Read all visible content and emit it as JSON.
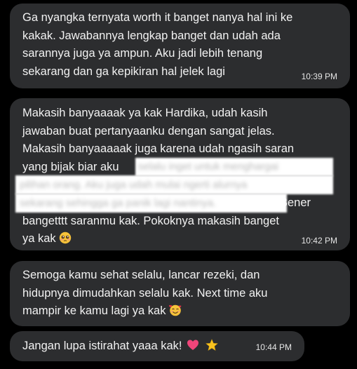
{
  "messages": [
    {
      "lines": [
        "Ga nyangka ternyata worth it banget nanya hal ini ke",
        "kakak. Jawabannya lengkap banget dan udah ada",
        "sarannya juga ya ampun. Aku jadi lebih tenang",
        "sekarang dan ga kepikiran hal jelek lagi"
      ],
      "time": "10:39 PM"
    },
    {
      "lines": [
        "Makasih banyaaaak ya kak Hardika, udah kasih",
        "jawaban buat pertanyaanku dengan sangat jelas.",
        "Makasih banyaaaaak juga karena udah ngasih saran",
        "yang bijak biar aku",
        "",
        "",
        "Bener",
        "bangetttt saranmu kak. Pokoknya makasih banget",
        "ya kak"
      ],
      "emoji": "pleading-face-emoji",
      "time": "10:42 PM",
      "redacted_hint": [
        "selalu inget untuk menghargai",
        "pilihan orang. Aku juga udah mulai ngerti alurnya",
        "sekarang sehingga ga panik lagi nantinya."
      ]
    },
    {
      "lines": [
        "Semoga kamu sehat selalu, lancar rezeki, dan",
        "hidupnya dimudahkan selalu kak. Next time aku",
        "mampir ke kamu lagi ya kak"
      ],
      "emoji": "smiling-face-with-hearts-emoji",
      "time": ""
    },
    {
      "lines": [
        "Jangan lupa istirahat yaaa kak!"
      ],
      "emojis": [
        "pink-heart-emoji",
        "star-emoji"
      ],
      "time": "10:44 PM"
    }
  ],
  "colors": {
    "background": "#000000",
    "bubble": "#2c2d2f",
    "text": "#f2f2f2",
    "redaction": "#ffffff"
  }
}
